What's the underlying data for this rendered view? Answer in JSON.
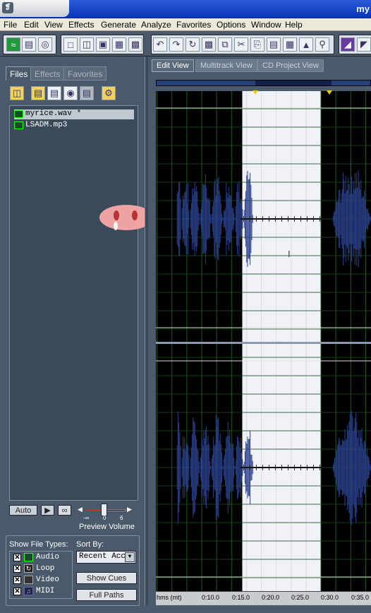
{
  "app": {
    "title_fragment": "my"
  },
  "menu": [
    "File",
    "Edit",
    "View",
    "Effects",
    "Generate",
    "Analyze",
    "Favorites",
    "Options",
    "Window",
    "Help"
  ],
  "left_tabs": {
    "files": "Files",
    "effects": "Effects",
    "favorites": "Favorites"
  },
  "files": [
    {
      "name": "myrice.wav *",
      "selected": true
    },
    {
      "name": "LSADM.mp3",
      "selected": false
    }
  ],
  "preview": {
    "auto_label": "Auto",
    "volume_label": "Preview Volume",
    "min_label": "-∞",
    "mid_label": "0",
    "max_label": "6"
  },
  "show_file_types": {
    "label": "Show File Types:",
    "items": [
      {
        "name": "Audio",
        "checked": true
      },
      {
        "name": "Loop",
        "checked": true
      },
      {
        "name": "Video",
        "checked": true
      },
      {
        "name": "MIDI",
        "checked": true
      }
    ]
  },
  "sort_by": {
    "label": "Sort By:",
    "value": "Recent Acce"
  },
  "buttons": {
    "show_cues": "Show Cues",
    "full_paths": "Full Paths"
  },
  "view_tabs": {
    "edit": "Edit View",
    "multitrack": "Multitrack View",
    "cd": "CD Project View"
  },
  "ruler": {
    "unit_label": "hms (mt)",
    "ticks": [
      {
        "label": "0:10.0"
      },
      {
        "label": "0:15.0"
      },
      {
        "label": "0:20.0"
      },
      {
        "label": "0:25.0"
      },
      {
        "label": "0:30.0"
      },
      {
        "label": "0:35.0"
      }
    ]
  },
  "selection": {
    "start_s": 16.8,
    "end_s": 30.0
  },
  "colors": {
    "waveform": "#2a3f8a",
    "selection": "#f0f2f8",
    "bg": "#000000",
    "grid": "#1e5a1e"
  }
}
